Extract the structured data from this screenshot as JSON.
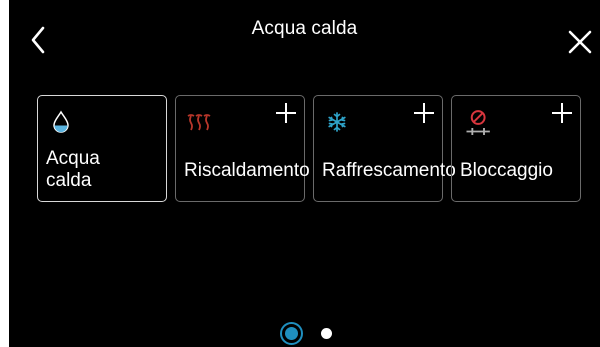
{
  "header": {
    "title": "Acqua calda"
  },
  "tiles": [
    {
      "label": "Acqua\ncalda",
      "icon": "water-drop-icon"
    },
    {
      "label": "Riscaldamento",
      "icon": "heating-icon"
    },
    {
      "label": "Raffrescamento",
      "icon": "snowflake-icon"
    },
    {
      "label": "Bloccaggio",
      "icon": "blocking-icon"
    }
  ],
  "colors": {
    "background": "#000000",
    "heating_icon": "#b8362a",
    "cooling_icon": "#2ea3c9",
    "blocking_icon": "#d9363e",
    "water_drop": "#5ab4df",
    "pager_active": "#1f8fbf"
  }
}
